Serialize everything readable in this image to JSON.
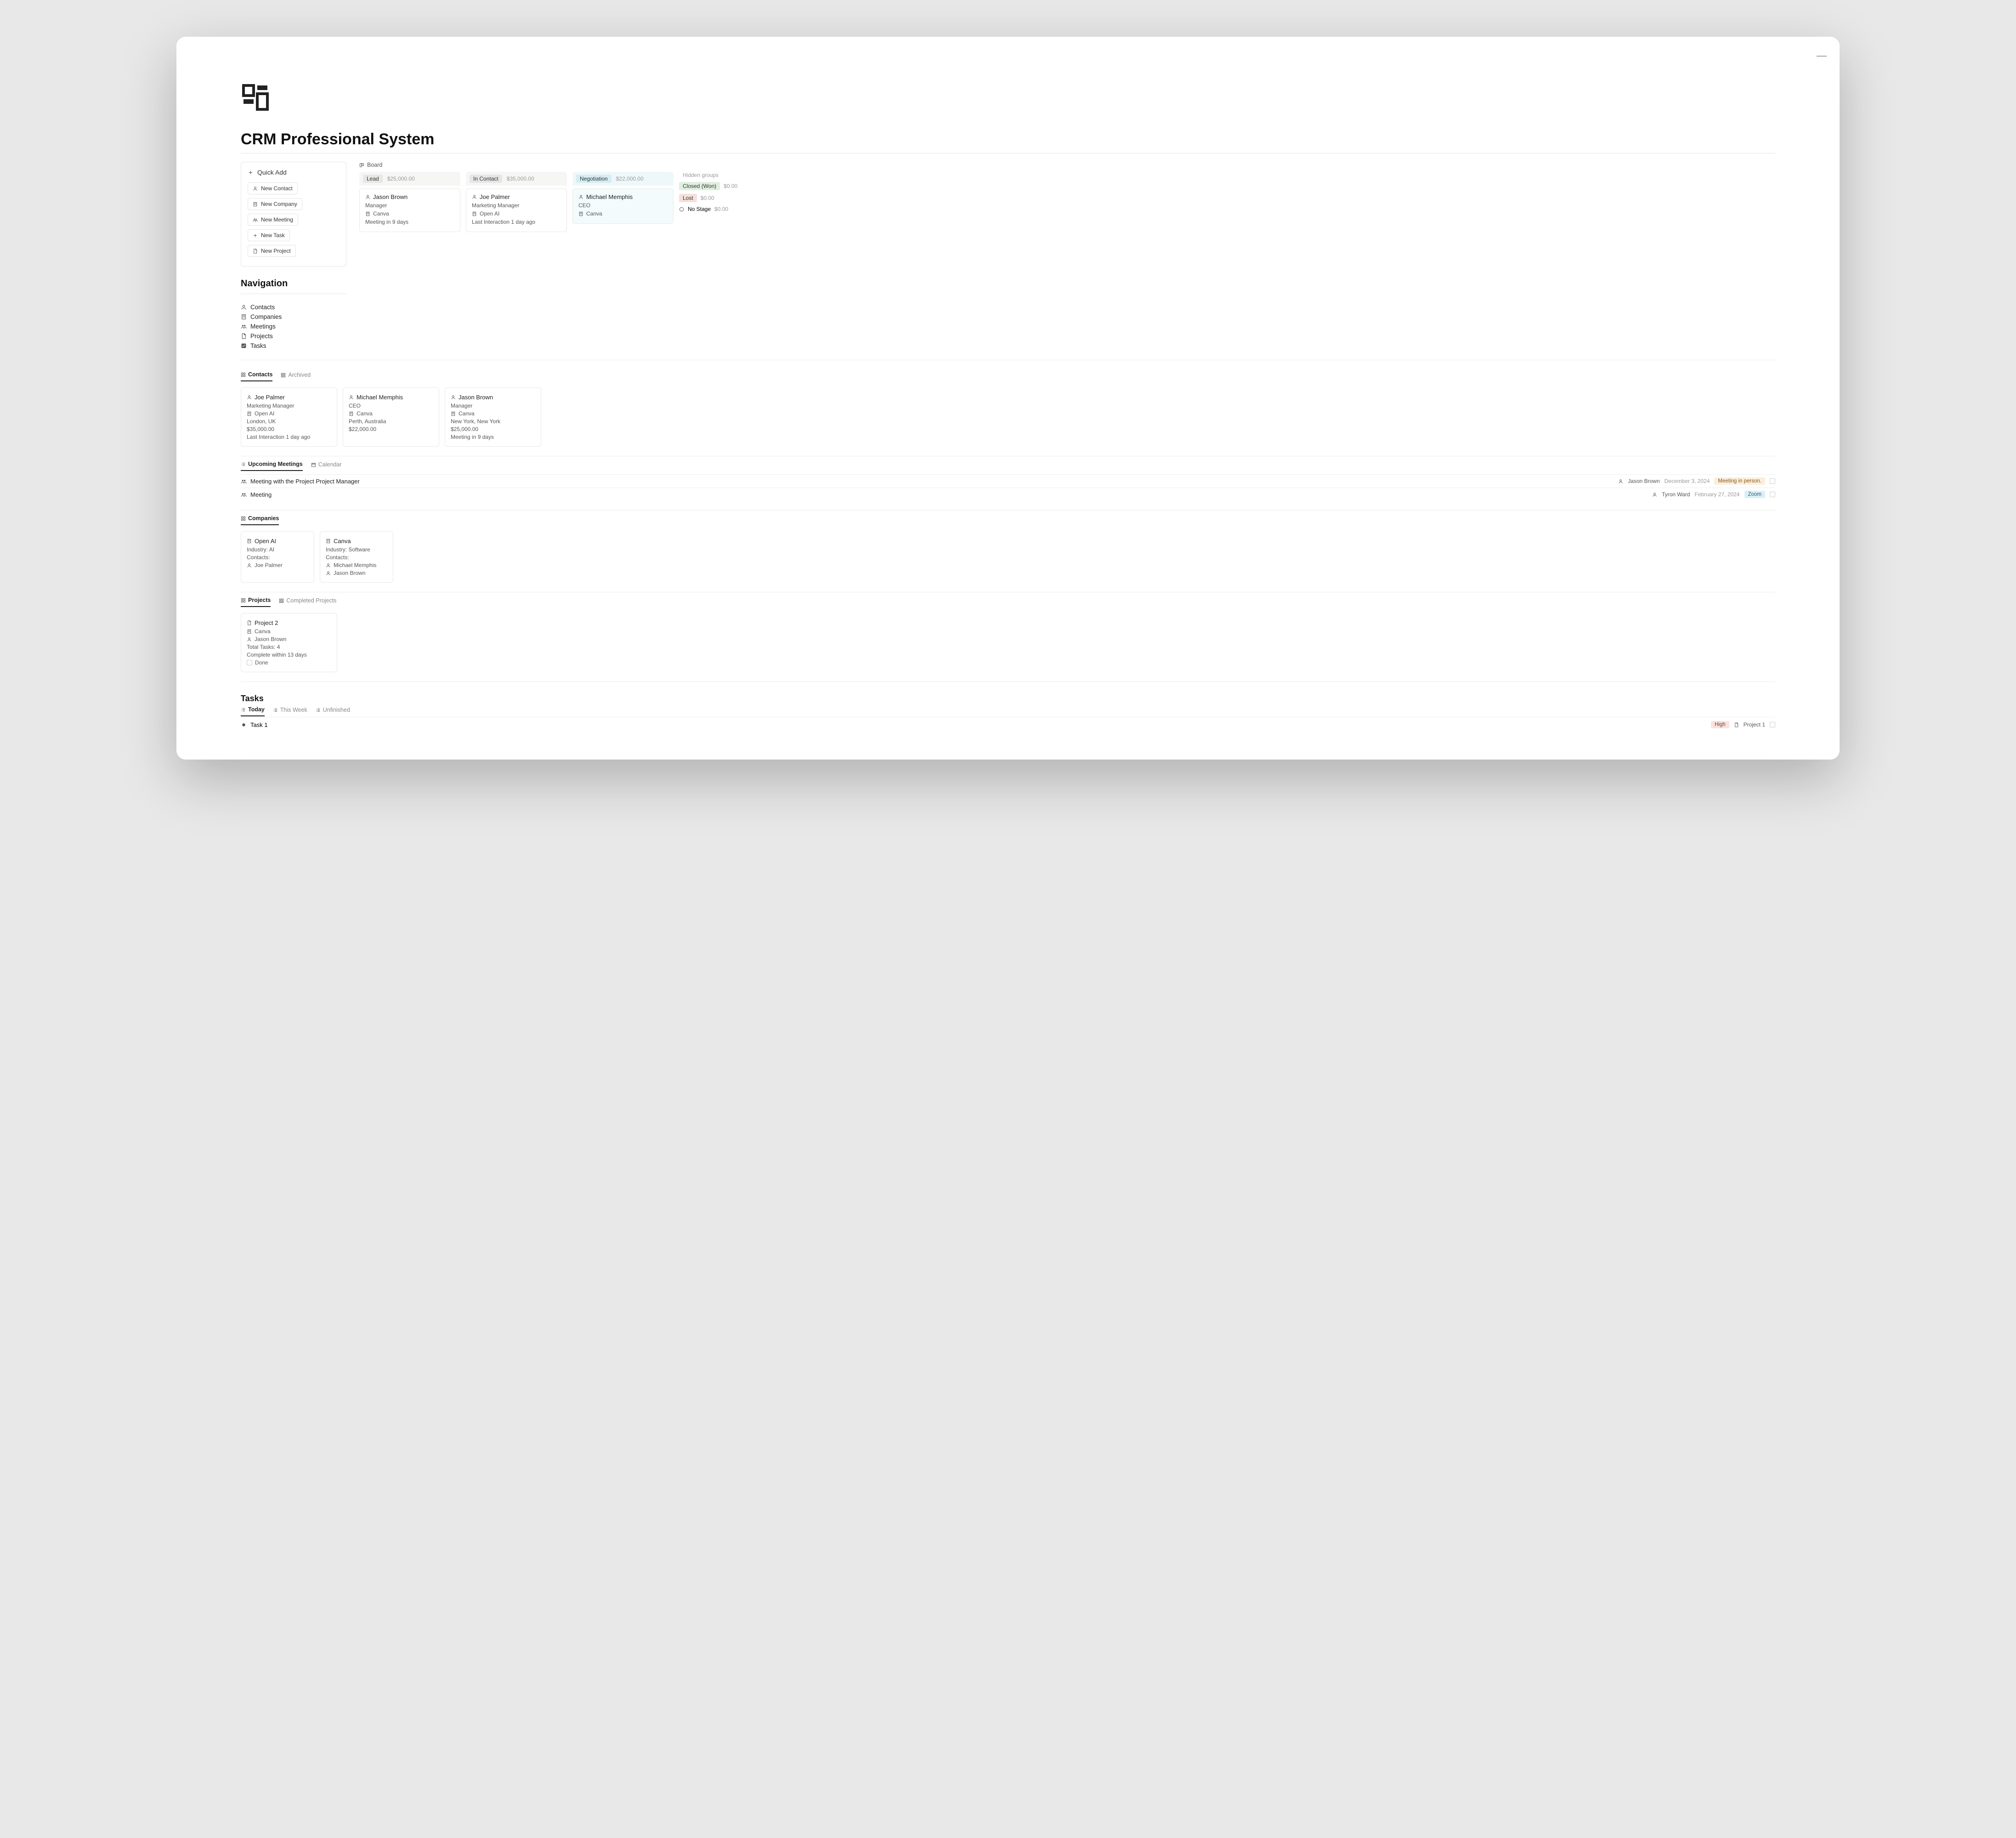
{
  "page": {
    "title": "CRM Professional System"
  },
  "quickAdd": {
    "header": "Quick Add",
    "buttons": {
      "contact": "New Contact",
      "company": "New Company",
      "meeting": "New Meeting",
      "task": "New Task",
      "project": "New Project"
    }
  },
  "board": {
    "label": "Board",
    "hiddenGroupsLabel": "Hidden groups",
    "columns": {
      "lead": {
        "stage": "Lead",
        "amount": "$25,000.00"
      },
      "contact": {
        "stage": "In Contact",
        "amount": "$35,000.00"
      },
      "neg": {
        "stage": "Negotiation",
        "amount": "$22,000.00"
      }
    },
    "hidden": {
      "closed": {
        "label": "Closed (Won)",
        "amount": "$0.00"
      },
      "lost": {
        "label": "Lost",
        "amount": "$0.00"
      },
      "nostage": {
        "label": "No Stage",
        "amount": "$0.00"
      }
    },
    "cards": {
      "lead": {
        "name": "Jason Brown",
        "role": "Manager",
        "company": "Canva",
        "meta": "Meeting in 9 days"
      },
      "contact": {
        "name": "Joe Palmer",
        "role": "Marketing Manager",
        "company": "Open AI",
        "meta": "Last Interaction 1 day ago"
      },
      "neg": {
        "name": "Michael Memphis",
        "role": "CEO",
        "company": "Canva",
        "meta": ""
      }
    }
  },
  "navigation": {
    "header": "Navigation",
    "items": {
      "contacts": "Contacts",
      "companies": "Companies",
      "meetings": "Meetings",
      "projects": "Projects",
      "tasks": "Tasks"
    }
  },
  "contactsSection": {
    "tabs": {
      "contacts": "Contacts",
      "archived": "Archived"
    },
    "cards": [
      {
        "name": "Joe Palmer",
        "role": "Marketing Manager",
        "company": "Open AI",
        "location": "London, UK",
        "amount": "$35,000.00",
        "meta": "Last Interaction 1 day ago"
      },
      {
        "name": "Michael Memphis",
        "role": "CEO",
        "company": "Canva",
        "location": "Perth, Australia",
        "amount": "$22,000.00",
        "meta": ""
      },
      {
        "name": "Jason Brown",
        "role": "Manager",
        "company": "Canva",
        "location": "New York, New York",
        "amount": "$25,000.00",
        "meta": "Meeting in 9 days"
      }
    ]
  },
  "meetings": {
    "tabs": {
      "upcoming": "Upcoming Meetings",
      "calendar": "Calendar"
    },
    "rows": [
      {
        "title": "Meeting with the Project Project Manager",
        "person": "Jason Brown",
        "date": "December 3, 2024",
        "badge": "Meeting in person.",
        "badgeClass": "pill-orange"
      },
      {
        "title": "Meeting",
        "person": "Tyron Ward",
        "date": "February 27, 2024",
        "badge": "Zoom",
        "badgeClass": "pill-blue"
      }
    ]
  },
  "companies": {
    "tab": "Companies",
    "cards": [
      {
        "name": "Open AI",
        "industry": "Industry: AI",
        "contactsLabel": "Contacts:",
        "contacts": [
          "Joe Palmer"
        ]
      },
      {
        "name": "Canva",
        "industry": "Industry: Software",
        "contactsLabel": "Contacts:",
        "contacts": [
          "Michael Memphis",
          "Jason Brown"
        ]
      }
    ]
  },
  "projects": {
    "tabs": {
      "active": "Projects",
      "completed": "Completed Projects"
    },
    "card": {
      "name": "Project 2",
      "company": "Canva",
      "person": "Jason Brown",
      "totalTasks": "Total Tasks: 4",
      "deadline": "Complete within 13 days",
      "doneLabel": "Done"
    }
  },
  "tasks": {
    "header": "Tasks",
    "tabs": {
      "today": "Today",
      "week": "This Week",
      "unfinished": "Unfinished"
    },
    "row": {
      "title": "Task 1",
      "priority": "High",
      "project": "Project 1"
    }
  }
}
